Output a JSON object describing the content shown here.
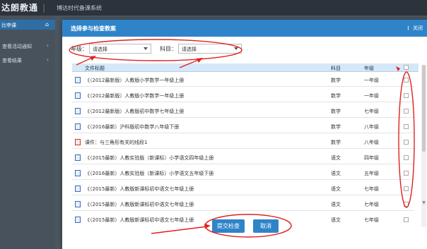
{
  "app": {
    "logo": "达朗教通",
    "system_name": "博达时代备课系统",
    "sidebar_head": "比申课",
    "sidebar_items": [
      "查看活动通知",
      "查看结果"
    ]
  },
  "modal": {
    "title": "选择参与检查教案",
    "close_label": "关闭",
    "grade_label": "年级：",
    "grade_select": "请选择",
    "subject_label": "科目：",
    "subject_select": "请选择",
    "columns": [
      "文件标题",
      "科目",
      "年级"
    ],
    "rows": [
      {
        "title": "《（2012最新版）人教版小学数学一年级上册",
        "subject": "数学",
        "grade": "一年级",
        "type": "doc"
      },
      {
        "title": "《（2012最新版）人教版小学数学一年级上册",
        "subject": "数学",
        "grade": "一年级",
        "type": "doc"
      },
      {
        "title": "《（2012最新版）人教版初中数学七年级上册",
        "subject": "数学",
        "grade": "七年级",
        "type": "doc"
      },
      {
        "title": "《（2016最新）沪科版初中数学八年级下册",
        "subject": "数学",
        "grade": "八年级",
        "type": "doc"
      },
      {
        "title": "课件：与三角形有关的线段1",
        "subject": "数学",
        "grade": "八年级",
        "type": "ppt"
      },
      {
        "title": "《（2015最新）人教实验版（新课标）小学语文四年级上册",
        "subject": "语文",
        "grade": "四年级",
        "type": "doc"
      },
      {
        "title": "《（2016最新）人教实验版（新课标）小学语文五年级下册",
        "subject": "语文",
        "grade": "五年级",
        "type": "doc"
      },
      {
        "title": "《（2015最新）人教版新课标初中语文七年级上册",
        "subject": "语文",
        "grade": "七年级",
        "type": "doc"
      },
      {
        "title": "《（2015最新）人教版新课标初中语文七年级上册",
        "subject": "语文",
        "grade": "七年级",
        "type": "doc"
      },
      {
        "title": "《（2015最新）人教版新课标初中语文七年级上册",
        "subject": "语文",
        "grade": "七年级",
        "type": "doc"
      }
    ],
    "submit_label": "提交检查",
    "cancel_label": "取消"
  },
  "colors": {
    "title_bar": "#2f84c9",
    "header_row": "#d6e8f8",
    "annotation": "#e02020"
  }
}
